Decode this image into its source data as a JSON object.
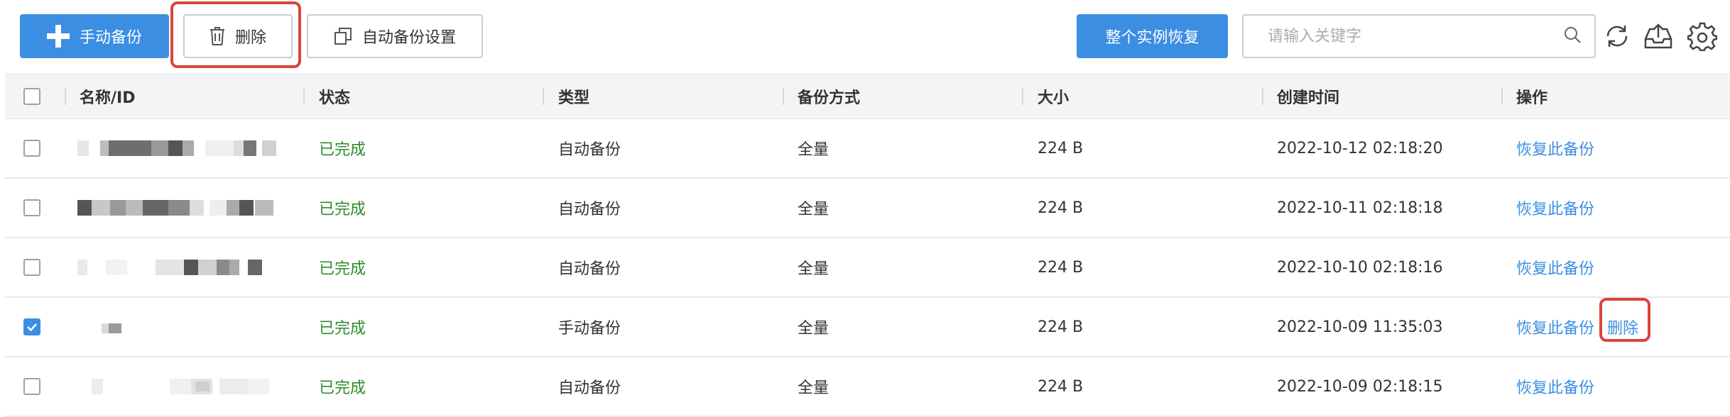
{
  "toolbar": {
    "manual_backup_label": "手动备份",
    "delete_label": "删除",
    "auto_backup_settings_label": "自动备份设置",
    "restore_instance_label": "整个实例恢复",
    "search_placeholder": "请输入关键字"
  },
  "table": {
    "headers": {
      "name": "名称/ID",
      "status": "状态",
      "type": "类型",
      "method": "备份方式",
      "size": "大小",
      "created": "创建时间",
      "actions": "操作"
    },
    "rows": [
      {
        "checked": false,
        "status": "已完成",
        "type": "自动备份",
        "method": "全量",
        "size": "224 B",
        "created": "2022-10-12 02:18:20",
        "restore": "恢复此备份",
        "delete": ""
      },
      {
        "checked": false,
        "status": "已完成",
        "type": "自动备份",
        "method": "全量",
        "size": "224 B",
        "created": "2022-10-11 02:18:18",
        "restore": "恢复此备份",
        "delete": ""
      },
      {
        "checked": false,
        "status": "已完成",
        "type": "自动备份",
        "method": "全量",
        "size": "224 B",
        "created": "2022-10-10 02:18:16",
        "restore": "恢复此备份",
        "delete": ""
      },
      {
        "checked": true,
        "status": "已完成",
        "type": "手动备份",
        "method": "全量",
        "size": "224 B",
        "created": "2022-10-09 11:35:03",
        "restore": "恢复此备份",
        "delete": "删除"
      },
      {
        "checked": false,
        "status": "已完成",
        "type": "自动备份",
        "method": "全量",
        "size": "224 B",
        "created": "2022-10-09 02:18:15",
        "restore": "恢复此备份",
        "delete": ""
      }
    ]
  },
  "icons": {
    "plus": "plus-icon",
    "trash": "trash-icon",
    "copy": "copy-icon",
    "search": "search-icon",
    "refresh": "refresh-icon",
    "upload": "cloud-upload-icon",
    "settings": "gear-icon"
  },
  "colors": {
    "primary": "#3c8ee3",
    "success": "#2e8b2e",
    "highlight": "#d9453a"
  }
}
